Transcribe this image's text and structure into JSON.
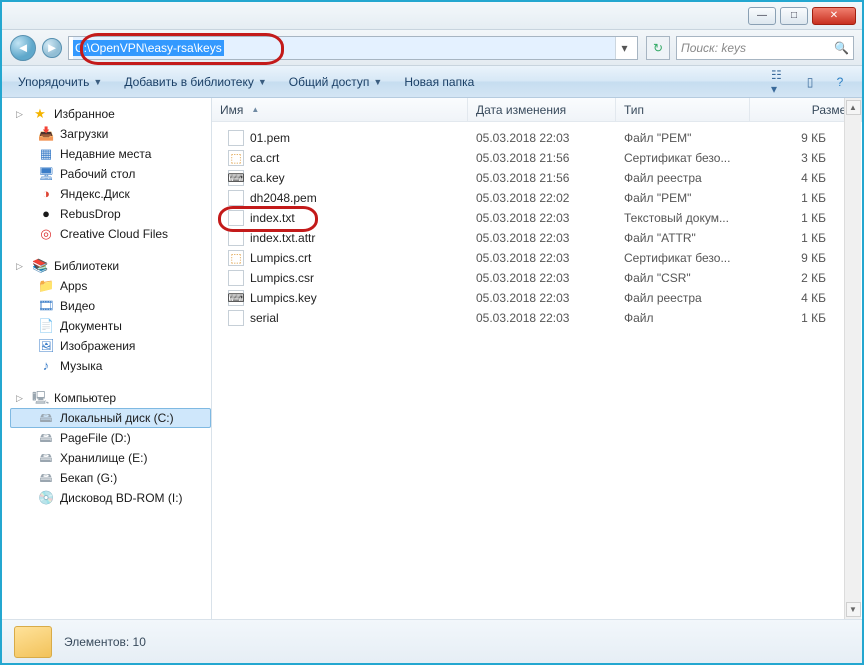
{
  "window": {
    "address_path": "C:\\OpenVPN\\easy-rsa\\keys",
    "search_placeholder": "Поиск: keys"
  },
  "toolbar": {
    "organize": "Упорядочить",
    "add_to_library": "Добавить в библиотеку",
    "share": "Общий доступ",
    "new_folder": "Новая папка"
  },
  "sidebar": {
    "favorites_label": "Избранное",
    "favorites": [
      "Загрузки",
      "Недавние места",
      "Рабочий стол",
      "Яндекс.Диск",
      "RebusDrop",
      "Creative Cloud Files"
    ],
    "libraries_label": "Библиотеки",
    "libraries": [
      "Apps",
      "Видео",
      "Документы",
      "Изображения",
      "Музыка"
    ],
    "computer_label": "Компьютер",
    "computer": [
      "Локальный диск (C:)",
      "PageFile (D:)",
      "Хранилище (E:)",
      "Бекап (G:)",
      "Дисковод BD-ROM (I:)"
    ]
  },
  "columns": {
    "name": "Имя",
    "date": "Дата изменения",
    "type": "Тип",
    "size": "Размер"
  },
  "files": [
    {
      "name": "01.pem",
      "date": "05.03.2018 22:03",
      "type": "Файл \"PEM\"",
      "size": "9 КБ",
      "icon": "pg"
    },
    {
      "name": "ca.crt",
      "date": "05.03.2018 21:56",
      "type": "Сертификат безо...",
      "size": "3 КБ",
      "icon": "crt"
    },
    {
      "name": "ca.key",
      "date": "05.03.2018 21:56",
      "type": "Файл реестра",
      "size": "4 КБ",
      "icon": "key"
    },
    {
      "name": "dh2048.pem",
      "date": "05.03.2018 22:02",
      "type": "Файл \"PEM\"",
      "size": "1 КБ",
      "icon": "pg"
    },
    {
      "name": "index.txt",
      "date": "05.03.2018 22:03",
      "type": "Текстовый докум...",
      "size": "1 КБ",
      "icon": "pg"
    },
    {
      "name": "index.txt.attr",
      "date": "05.03.2018 22:03",
      "type": "Файл \"ATTR\"",
      "size": "1 КБ",
      "icon": "pg"
    },
    {
      "name": "Lumpics.crt",
      "date": "05.03.2018 22:03",
      "type": "Сертификат безо...",
      "size": "9 КБ",
      "icon": "crt"
    },
    {
      "name": "Lumpics.csr",
      "date": "05.03.2018 22:03",
      "type": "Файл \"CSR\"",
      "size": "2 КБ",
      "icon": "pg"
    },
    {
      "name": "Lumpics.key",
      "date": "05.03.2018 22:03",
      "type": "Файл реестра",
      "size": "4 КБ",
      "icon": "key"
    },
    {
      "name": "serial",
      "date": "05.03.2018 22:03",
      "type": "Файл",
      "size": "1 КБ",
      "icon": "pg"
    }
  ],
  "preview": {
    "count_label": "Элементов: 10"
  }
}
